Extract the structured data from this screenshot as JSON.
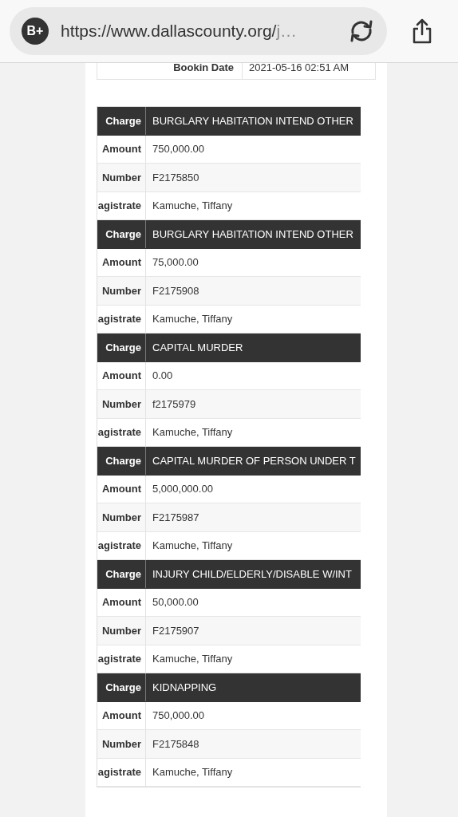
{
  "browser": {
    "badge": "B+",
    "url": "https://www.dallascounty.org/",
    "url_rest": "j…"
  },
  "booking": {
    "label": "Bookin Date",
    "value": "2021-05-16 02:51 AM"
  },
  "charges": [
    {
      "rows": [
        {
          "kind": "header",
          "label": "Charge",
          "value": "BURGLARY HABITATION INTEND OTHER"
        },
        {
          "kind": "plain",
          "label": "Amount",
          "value": "750,000.00"
        },
        {
          "kind": "shaded",
          "label": "Number",
          "value": "F2175850"
        },
        {
          "kind": "plain",
          "label": "agistrate",
          "value": "Kamuche, Tiffany"
        }
      ]
    },
    {
      "rows": [
        {
          "kind": "header",
          "label": "Charge",
          "value": "BURGLARY HABITATION INTEND OTHER"
        },
        {
          "kind": "plain",
          "label": "Amount",
          "value": "75,000.00"
        },
        {
          "kind": "shaded",
          "label": "Number",
          "value": "F2175908"
        },
        {
          "kind": "plain",
          "label": "agistrate",
          "value": "Kamuche, Tiffany"
        }
      ]
    },
    {
      "rows": [
        {
          "kind": "header",
          "label": "Charge",
          "value": "CAPITAL MURDER"
        },
        {
          "kind": "plain",
          "label": "Amount",
          "value": "0.00"
        },
        {
          "kind": "shaded",
          "label": "Number",
          "value": "f2175979"
        },
        {
          "kind": "plain",
          "label": "agistrate",
          "value": "Kamuche, Tiffany"
        }
      ]
    },
    {
      "rows": [
        {
          "kind": "header",
          "label": "Charge",
          "value": "CAPITAL MURDER OF PERSON UNDER T"
        },
        {
          "kind": "plain",
          "label": "Amount",
          "value": "5,000,000.00"
        },
        {
          "kind": "shaded",
          "label": "Number",
          "value": "F2175987"
        },
        {
          "kind": "plain",
          "label": "agistrate",
          "value": "Kamuche, Tiffany"
        }
      ]
    },
    {
      "rows": [
        {
          "kind": "header",
          "label": "Charge",
          "value": "INJURY CHILD/ELDERLY/DISABLE W/INT"
        },
        {
          "kind": "plain",
          "label": "Amount",
          "value": "50,000.00"
        },
        {
          "kind": "shaded",
          "label": "Number",
          "value": "F2175907"
        },
        {
          "kind": "plain",
          "label": "agistrate",
          "value": "Kamuche, Tiffany"
        }
      ]
    },
    {
      "rows": [
        {
          "kind": "header",
          "label": "Charge",
          "value": "KIDNAPPING"
        },
        {
          "kind": "plain",
          "label": "Amount",
          "value": "750,000.00"
        },
        {
          "kind": "shaded",
          "label": "Number",
          "value": "F2175848"
        },
        {
          "kind": "plain",
          "label": "agistrate",
          "value": "Kamuche, Tiffany"
        }
      ]
    }
  ]
}
